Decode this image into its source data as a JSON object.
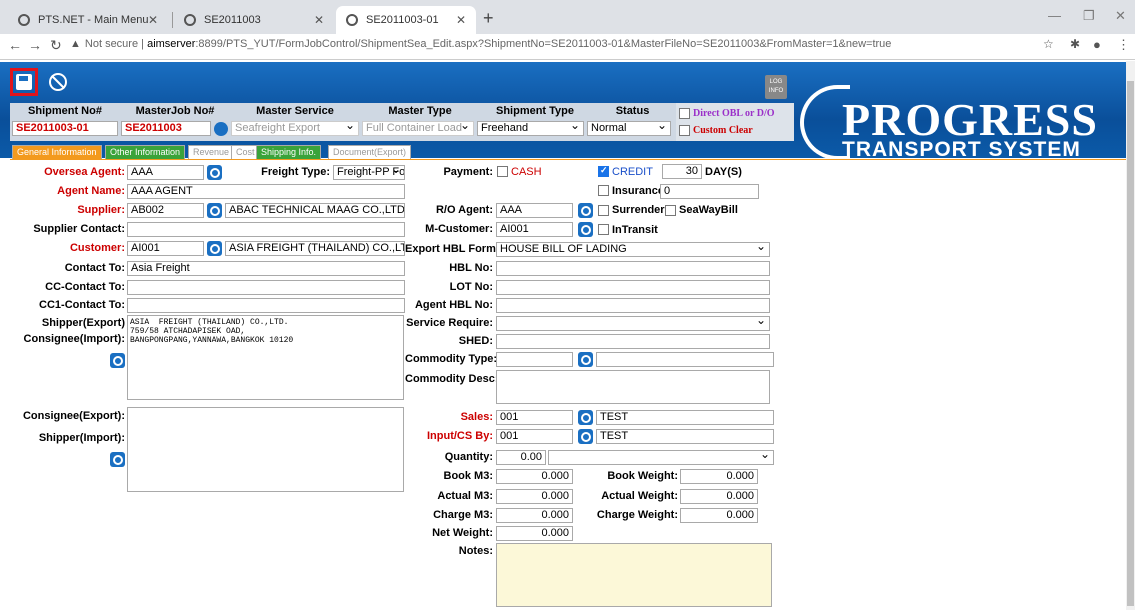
{
  "browser": {
    "tabs": [
      {
        "title": "PTS.NET - Main Menu"
      },
      {
        "title": "SE2011003"
      },
      {
        "title": "SE2011003-01"
      }
    ],
    "security": "Not secure",
    "url_host": "aimserver",
    "url_rest": ":8899/PTS_YUT/FormJobControl/ShipmentSea_Edit.aspx?ShipmentNo=SE2011003-01&MasterFileNo=SE2011003&FromMaster=1&new=true"
  },
  "toolbar": {
    "log_info": "LOG INFO"
  },
  "logo": {
    "line1": "PROGRESS",
    "line2": "TRANSPORT SYSTEM"
  },
  "header": {
    "shipment_no_label": "Shipment No#",
    "shipment_no": "SE2011003-01",
    "masterjob_label": "MasterJob No#",
    "masterjob": "SE2011003",
    "master_service_label": "Master Service",
    "master_service": "Seafreight Export",
    "master_type_label": "Master Type",
    "master_type": "Full Container Load",
    "shipment_type_label": "Shipment Type",
    "shipment_type": "Freehand",
    "status_label": "Status",
    "status": "Normal",
    "direct_obl": "Direct OBL or D/O",
    "custom_clear": "Custom Clear"
  },
  "tabs": [
    "General Information",
    "Other Information",
    "Revenue",
    "Cost",
    "Shipping Info.",
    "Document(Export)"
  ],
  "form": {
    "oversea_agent_label": "Oversea Agent:",
    "oversea_agent": "AAA",
    "freight_type_label": "Freight Type:",
    "freight_type": "Freight-PP For",
    "payment_label": "Payment:",
    "cash": "CASH",
    "credit": "CREDIT",
    "credit_days": "30",
    "days_unit": "DAY(S)",
    "agent_name_label": "Agent Name:",
    "agent_name": "AAA AGENT",
    "insurance_label": "Insurance",
    "insurance": "0",
    "supplier_label": "Supplier:",
    "supplier_code": "AB002",
    "supplier_name": "ABAC TECHNICAL MAAG CO.,LTD.",
    "ro_agent_label": "R/O Agent:",
    "ro_agent": "AAA",
    "surrender": "Surrender",
    "seawaybill": "SeaWayBill",
    "supplier_contact_label": "Supplier Contact:",
    "m_customer_label": "M-Customer:",
    "m_customer": "AI001",
    "intransit": "InTransit",
    "customer_label": "Customer:",
    "customer_code": "AI001",
    "customer_name": "ASIA FREIGHT (THAILAND) CO.,LTD.",
    "export_hbl_label": "Export HBL Form:",
    "export_hbl": "HOUSE BILL OF LADING",
    "contact_to_label": "Contact To:",
    "contact_to": "Asia Freight",
    "hbl_no_label": "HBL No:",
    "cc_contact_label": "CC-Contact To:",
    "lot_no_label": "LOT No:",
    "cc1_contact_label": "CC1-Contact To:",
    "agent_hbl_label": "Agent HBL No:",
    "shipper_export_label": "Shipper(Export)",
    "consignee_import_label": "Consignee(Import):",
    "shipper_text": "ASIA  FREIGHT (THAILAND) CO.,LTD.\n759/58 ATCHADAPISEK OAD,\nBANGPONGPANG,YANNAWA,BANGKOK 10120",
    "service_require_label": "Service Require:",
    "shed_label": "SHED:",
    "commodity_type_label": "Commodity Type:",
    "commodity_desc_label": "Commodity Desc:",
    "consignee_export_label": "Consignee(Export):",
    "shipper_import_label": "Shipper(Import):",
    "sales_label": "Sales:",
    "sales_code": "001",
    "sales_name": "TEST",
    "input_cs_label": "Input/CS By:",
    "input_cs_code": "001",
    "input_cs_name": "TEST",
    "quantity_label": "Quantity:",
    "quantity": "0.00",
    "book_m3_label": "Book M3:",
    "book_m3": "0.000",
    "book_weight_label": "Book Weight:",
    "book_weight": "0.000",
    "actual_m3_label": "Actual M3:",
    "actual_m3": "0.000",
    "actual_weight_label": "Actual Weight:",
    "actual_weight": "0.000",
    "charge_m3_label": "Charge M3:",
    "charge_m3": "0.000",
    "charge_weight_label": "Charge Weight:",
    "charge_weight": "0.000",
    "net_weight_label": "Net Weight:",
    "net_weight": "0.000",
    "notes_label": "Notes:"
  }
}
